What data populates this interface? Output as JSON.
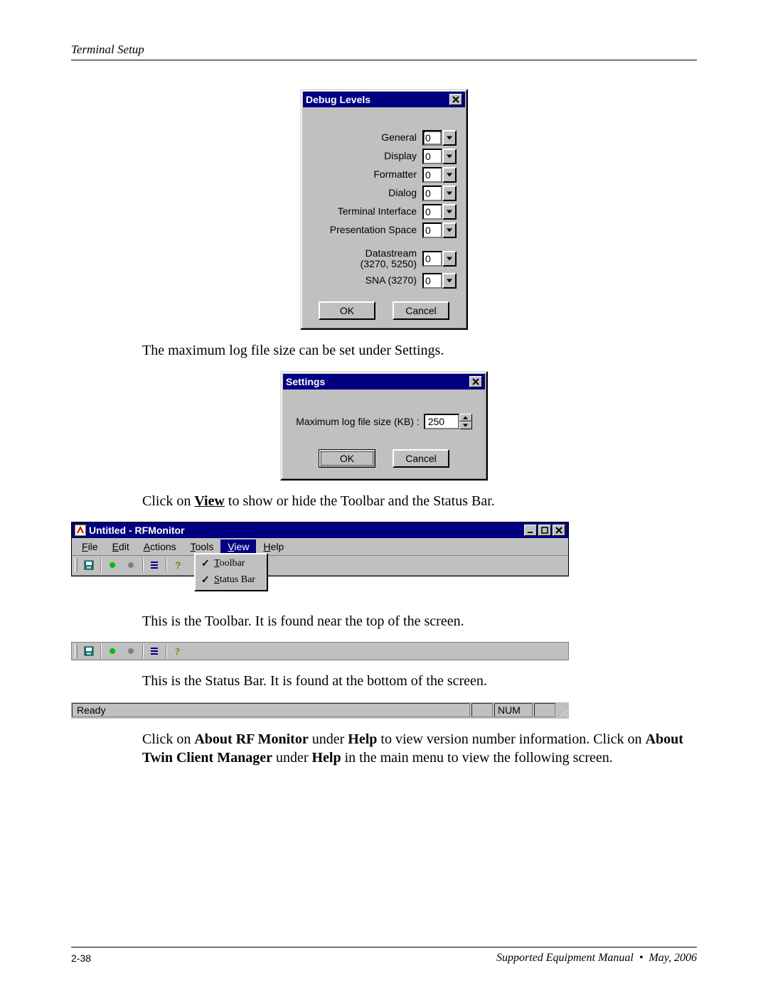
{
  "header": {
    "section": "Terminal Setup"
  },
  "debug_dialog": {
    "title": "Debug Levels",
    "fields": [
      {
        "label": "General",
        "value": "0"
      },
      {
        "label": "Display",
        "value": "0"
      },
      {
        "label": "Formatter",
        "value": "0"
      },
      {
        "label": "Dialog",
        "value": "0"
      },
      {
        "label": "Terminal Interface",
        "value": "0"
      },
      {
        "label": "Presentation Space",
        "value": "0"
      },
      {
        "label": "Datastream\n(3270, 5250)",
        "value": "0"
      },
      {
        "label": "SNA (3270)",
        "value": "0"
      }
    ],
    "ok": "OK",
    "cancel": "Cancel"
  },
  "para1": "The maximum log file size can be set under Settings.",
  "settings_dialog": {
    "title": "Settings",
    "label": "Maximum log file size (KB) :",
    "value": "250",
    "ok": "OK",
    "cancel": "Cancel"
  },
  "para2_pre": "Click on ",
  "para2_bold": "View",
  "para2_post": " to show or hide the Toolbar and the Status Bar.",
  "app_window": {
    "title": "Untitled - RFMonitor",
    "menus": [
      {
        "label": "File",
        "ul": "F"
      },
      {
        "label": "Edit",
        "ul": "E"
      },
      {
        "label": "Actions",
        "ul": "A"
      },
      {
        "label": "Tools",
        "ul": "T"
      },
      {
        "label": "View",
        "ul": "V",
        "selected": true
      },
      {
        "label": "Help",
        "ul": "H"
      }
    ],
    "view_menu": [
      {
        "label": "Toolbar",
        "ul": "T",
        "checked": true
      },
      {
        "label": "Status Bar",
        "ul": "S",
        "checked": true
      }
    ]
  },
  "para3": "This is the Toolbar. It is found near the top of the screen.",
  "para4": "This is the Status Bar. It is found at the bottom of the screen.",
  "statusbar": {
    "ready": "Ready",
    "num": "NUM"
  },
  "para5": {
    "t1": "Click on ",
    "b1": "About RF Monitor",
    "t2": " under ",
    "b2": "Help",
    "t3": " to view version number information. Click on ",
    "b3": "About Twin Client Manager",
    "t4": " under ",
    "b4": "Help",
    "t5": " in the main menu to view the following screen."
  },
  "footer": {
    "page": "2-38",
    "text": "Supported Equipment Manual",
    "date": "May, 2006"
  }
}
